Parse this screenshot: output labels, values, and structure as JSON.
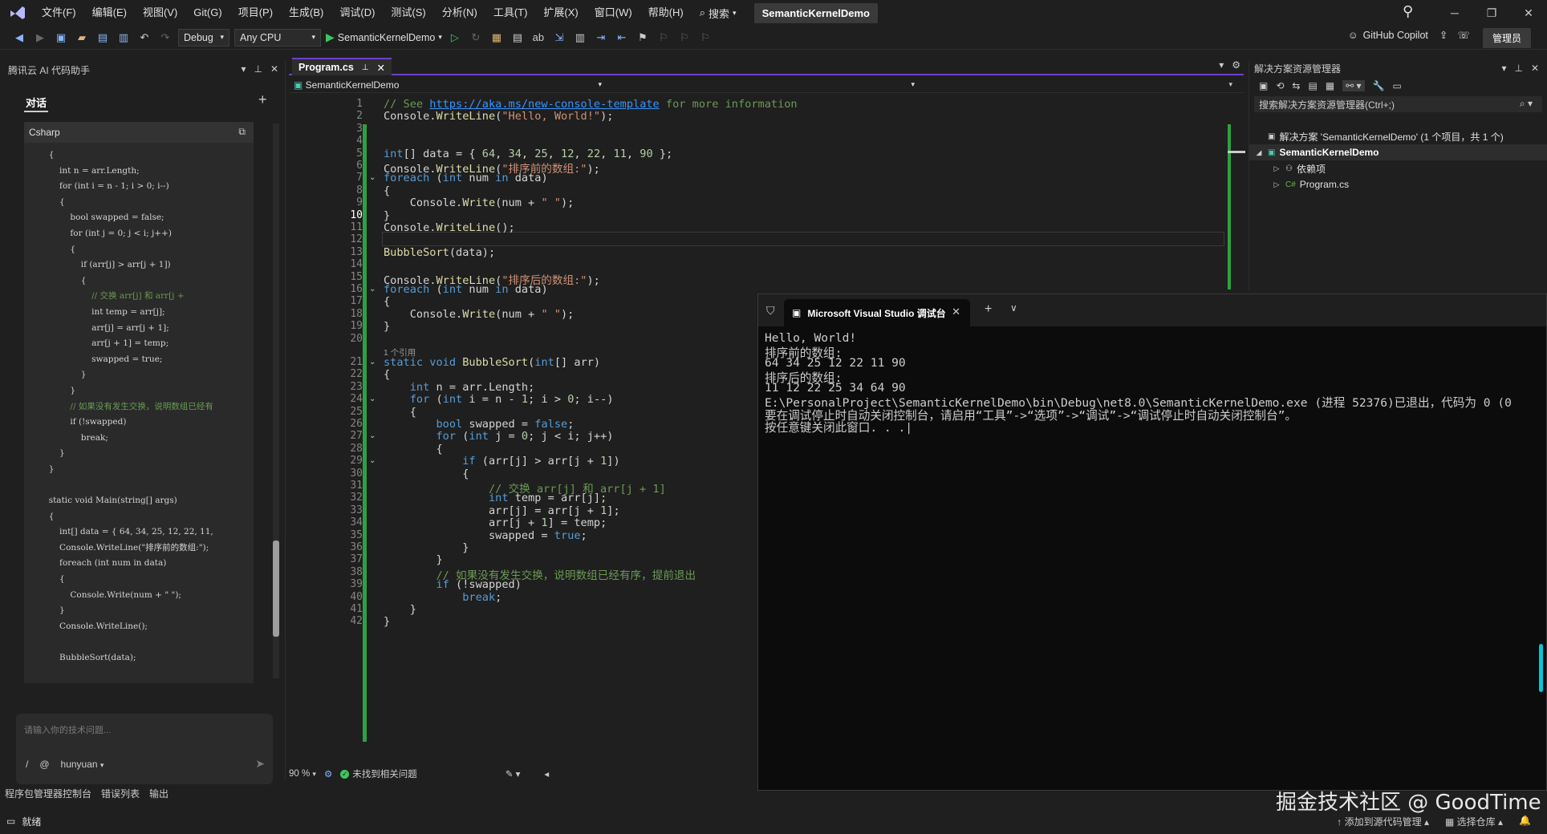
{
  "menubar": {
    "items": [
      "文件(F)",
      "编辑(E)",
      "视图(V)",
      "Git(G)",
      "项目(P)",
      "生成(B)",
      "调试(D)",
      "测试(S)",
      "分析(N)",
      "工具(T)",
      "扩展(X)",
      "窗口(W)",
      "帮助(H)"
    ],
    "search_label": "搜索",
    "solution_title": "SemanticKernelDemo"
  },
  "toolbar": {
    "config": "Debug",
    "platform": "Any CPU",
    "run_target": "SemanticKernelDemo",
    "copilot": "GitHub Copilot",
    "admin": "管理员"
  },
  "ai_panel": {
    "title": "腾讯云 AI 代码助手",
    "chat_tab": "对话",
    "card_language": "Csharp",
    "card_code": [
      {
        "t": "        {",
        "cls": ""
      },
      {
        "t": "            int n = arr.Length;",
        "cls": ""
      },
      {
        "t": "            for (int i = n - 1; i > 0; i--)",
        "cls": ""
      },
      {
        "t": "            {",
        "cls": ""
      },
      {
        "t": "                bool swapped = false;",
        "cls": ""
      },
      {
        "t": "                for (int j = 0; j < i; j++)",
        "cls": ""
      },
      {
        "t": "                {",
        "cls": ""
      },
      {
        "t": "                    if (arr[j] > arr[j + 1])",
        "cls": ""
      },
      {
        "t": "                    {",
        "cls": ""
      },
      {
        "t": "                        // 交换 arr[j] 和 arr[j +",
        "cls": "c"
      },
      {
        "t": "                        int temp = arr[j];",
        "cls": ""
      },
      {
        "t": "                        arr[j] = arr[j + 1];",
        "cls": ""
      },
      {
        "t": "                        arr[j + 1] = temp;",
        "cls": ""
      },
      {
        "t": "                        swapped = true;",
        "cls": ""
      },
      {
        "t": "                    }",
        "cls": ""
      },
      {
        "t": "                }",
        "cls": ""
      },
      {
        "t": "                // 如果没有发生交换，说明数组已经有",
        "cls": "c"
      },
      {
        "t": "                if (!swapped)",
        "cls": ""
      },
      {
        "t": "                    break;",
        "cls": ""
      },
      {
        "t": "            }",
        "cls": ""
      },
      {
        "t": "        }",
        "cls": ""
      },
      {
        "t": "",
        "cls": ""
      },
      {
        "t": "        static void Main(string[] args)",
        "cls": ""
      },
      {
        "t": "        {",
        "cls": ""
      },
      {
        "t": "            int[] data = { 64, 34, 25, 12, 22, 11,",
        "cls": ""
      },
      {
        "t": "            Console.WriteLine(\"排序前的数组:\");",
        "cls": ""
      },
      {
        "t": "            foreach (int num in data)",
        "cls": ""
      },
      {
        "t": "            {",
        "cls": ""
      },
      {
        "t": "                Console.Write(num + \" \");",
        "cls": ""
      },
      {
        "t": "            }",
        "cls": ""
      },
      {
        "t": "            Console.WriteLine();",
        "cls": ""
      },
      {
        "t": "",
        "cls": ""
      },
      {
        "t": "            BubbleSort(data);",
        "cls": ""
      }
    ],
    "input_placeholder": "请输入你的技术问题...",
    "input_slash": "/",
    "input_at": "@",
    "model": "hunyuan"
  },
  "editor": {
    "tab_name": "Program.cs",
    "nav_project": "SemanticKernelDemo",
    "current_line": 10,
    "ref_hint": "1 个引用",
    "lines": [
      {
        "n": 1,
        "html": "<span class='c'>// See </span><a>https://aka.ms/new-console-template</a><span class='c'> for more information</span>"
      },
      {
        "n": 2,
        "html": "Console.<span class='f'>WriteLine</span>(<span class='s'>\"Hello, World!\"</span>);"
      },
      {
        "n": 3,
        "html": ""
      },
      {
        "n": 4,
        "html": ""
      },
      {
        "n": 5,
        "html": "<span class='k'>int</span>[] data = { <span class='n'>64</span>, <span class='n'>34</span>, <span class='n'>25</span>, <span class='n'>12</span>, <span class='n'>22</span>, <span class='n'>11</span>, <span class='n'>90</span> };"
      },
      {
        "n": 6,
        "html": "Console.<span class='f'>WriteLine</span>(<span class='s'>\"排序前的数组:\"</span>);"
      },
      {
        "n": 7,
        "html": "<span class='k'>foreach</span> (<span class='k'>int</span> num <span class='k'>in</span> data)"
      },
      {
        "n": 8,
        "html": "{"
      },
      {
        "n": 9,
        "html": "    Console.<span class='f'>Write</span>(num + <span class='s'>\" \"</span>);"
      },
      {
        "n": 10,
        "html": "}"
      },
      {
        "n": 11,
        "html": "Console.<span class='f'>WriteLine</span>();"
      },
      {
        "n": 12,
        "html": ""
      },
      {
        "n": 13,
        "html": "<span class='f'>BubbleSort</span>(data);"
      },
      {
        "n": 14,
        "html": ""
      },
      {
        "n": 15,
        "html": "Console.<span class='f'>WriteLine</span>(<span class='s'>\"排序后的数组:\"</span>);"
      },
      {
        "n": 16,
        "html": "<span class='k'>foreach</span> (<span class='k'>int</span> num <span class='k'>in</span> data)"
      },
      {
        "n": 17,
        "html": "{"
      },
      {
        "n": 18,
        "html": "    Console.<span class='f'>Write</span>(num + <span class='s'>\" \"</span>);"
      },
      {
        "n": 19,
        "html": "}"
      },
      {
        "n": 20,
        "html": ""
      },
      {
        "n": 21,
        "html": "<span class='k'>static</span> <span class='k'>void</span> <span class='f'>BubbleSort</span>(<span class='k'>int</span>[] arr)"
      },
      {
        "n": 22,
        "html": "{"
      },
      {
        "n": 23,
        "html": "    <span class='k'>int</span> n = arr.Length;"
      },
      {
        "n": 24,
        "html": "    <span class='k'>for</span> (<span class='k'>int</span> i = n - <span class='n'>1</span>; i &gt; <span class='n'>0</span>; i--)"
      },
      {
        "n": 25,
        "html": "    {"
      },
      {
        "n": 26,
        "html": "        <span class='k'>bool</span> swapped = <span class='k'>false</span>;"
      },
      {
        "n": 27,
        "html": "        <span class='k'>for</span> (<span class='k'>int</span> j = <span class='n'>0</span>; j &lt; i; j++)"
      },
      {
        "n": 28,
        "html": "        {"
      },
      {
        "n": 29,
        "html": "            <span class='k'>if</span> (arr[j] &gt; arr[j + <span class='n'>1</span>])"
      },
      {
        "n": 30,
        "html": "            {"
      },
      {
        "n": 31,
        "html": "                <span class='c'>// 交换 arr[j] 和 arr[j + 1]</span>"
      },
      {
        "n": 32,
        "html": "                <span class='k'>int</span> temp = arr[j];"
      },
      {
        "n": 33,
        "html": "                arr[j] = arr[j + <span class='n'>1</span>];"
      },
      {
        "n": 34,
        "html": "                arr[j + <span class='n'>1</span>] = temp;"
      },
      {
        "n": 35,
        "html": "                swapped = <span class='k'>true</span>;"
      },
      {
        "n": 36,
        "html": "            }"
      },
      {
        "n": 37,
        "html": "        }"
      },
      {
        "n": 38,
        "html": "        <span class='c'>// 如果没有发生交换，说明数组已经有序，提前退出</span>"
      },
      {
        "n": 39,
        "html": "        <span class='k'>if</span> (!swapped)"
      },
      {
        "n": 40,
        "html": "            <span class='k'>break</span>;"
      },
      {
        "n": 41,
        "html": "    }"
      },
      {
        "n": 42,
        "html": "}"
      }
    ],
    "fold_lines": [
      7,
      16,
      21,
      24,
      27,
      29
    ],
    "zoom": "90 %",
    "issues": "未找到相关问题"
  },
  "solution_explorer": {
    "title": "解决方案资源管理器",
    "search_placeholder": "搜索解决方案资源管理器(Ctrl+;)",
    "solution": "解决方案 'SemanticKernelDemo' (1 个项目，共 1 个)",
    "project": "SemanticKernelDemo",
    "dependencies": "依赖项",
    "file": "Program.cs"
  },
  "console": {
    "tab_title": "Microsoft Visual Studio 调试台",
    "lines": [
      "Hello, World!",
      "排序前的数组:",
      "64 34 25 12 22 11 90",
      "排序后的数组:",
      "11 12 22 25 34 64 90",
      "E:\\PersonalProject\\SemanticKernelDemo\\bin\\Debug\\net8.0\\SemanticKernelDemo.exe (进程 52376)已退出，代码为 0 (0",
      "要在调试停止时自动关闭控制台，请启用“工具”->“选项”->“调试”->“调试停止时自动关闭控制台”。",
      "按任意键关闭此窗口. . .|"
    ]
  },
  "bottom_tabs": [
    "程序包管理器控制台",
    "错误列表",
    "输出"
  ],
  "status": {
    "ready": "就绪",
    "add_source": "添加到源代码管理",
    "select_repo": "选择仓库"
  },
  "watermark": "掘金技术社区 @ GoodTime"
}
